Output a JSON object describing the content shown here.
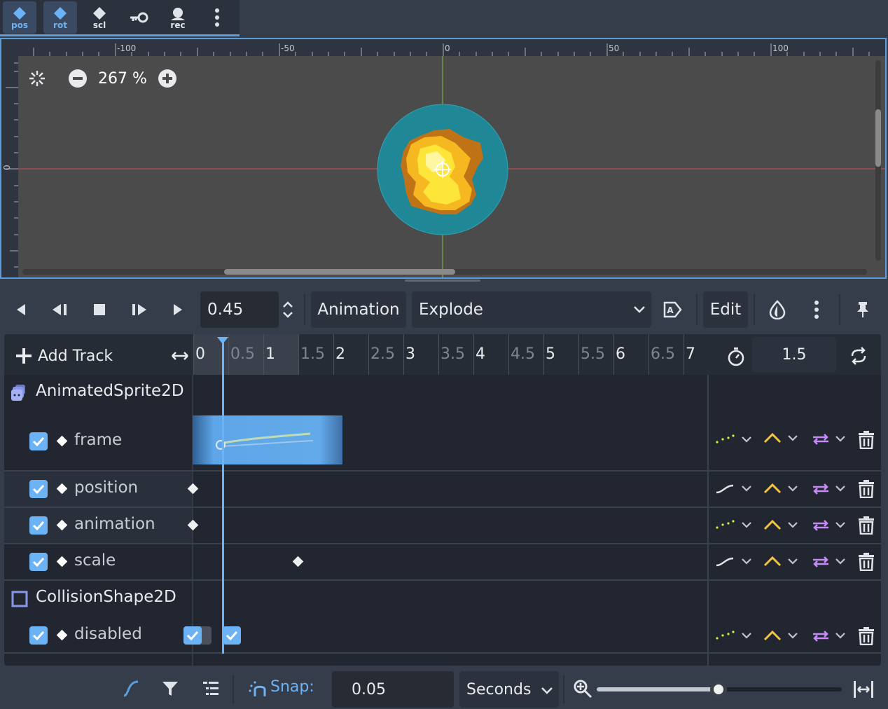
{
  "top_toolbar": {
    "buttons": [
      {
        "icon": "pos-key-icon",
        "label": "pos",
        "active": true
      },
      {
        "icon": "rot-key-icon",
        "label": "rot",
        "active": true
      },
      {
        "icon": "scl-key-icon",
        "label": "scl",
        "active": false
      },
      {
        "icon": "key-icon",
        "label": "",
        "active": false
      },
      {
        "icon": "rec-icon",
        "label": "rec",
        "active": false
      },
      {
        "icon": "more-vertical-icon",
        "label": "",
        "active": false
      }
    ]
  },
  "viewport": {
    "zoom": "267 %",
    "ruler_h_labels": [
      "-100",
      "-50",
      "0",
      "50",
      "100"
    ],
    "ruler_v_labels": [
      "0"
    ]
  },
  "anim_toolbar": {
    "time_value": "0.45",
    "animation_label": "Animation",
    "animation_selected": "Explode",
    "edit_label": "Edit"
  },
  "track_panel": {
    "add_track_label": "Add Track",
    "timeline_ticks": [
      "0",
      "0.5",
      "1",
      "1.5",
      "2",
      "2.5",
      "3",
      "3.5",
      "4",
      "4.5",
      "5",
      "5.5",
      "6",
      "6.5",
      "7"
    ],
    "length_value": "1.5",
    "playhead_time": 0.45,
    "groups": [
      {
        "name": "AnimatedSprite2D",
        "icon": "animated-sprite-icon",
        "tracks": [
          {
            "name": "frame",
            "enabled": true,
            "update_mode": "discrete",
            "keys": []
          },
          {
            "name": "position",
            "enabled": true,
            "update_mode": "continuous",
            "keys": [
              0
            ]
          },
          {
            "name": "animation",
            "enabled": true,
            "update_mode": "discrete",
            "keys": [
              0
            ]
          },
          {
            "name": "scale",
            "enabled": true,
            "update_mode": "continuous",
            "keys": [
              1.5
            ]
          }
        ]
      },
      {
        "name": "CollisionShape2D",
        "icon": "collision-shape-icon",
        "tracks": [
          {
            "name": "disabled",
            "enabled": true,
            "update_mode": "discrete",
            "keys": [
              0,
              0.5
            ]
          }
        ]
      }
    ]
  },
  "bottom_bar": {
    "snap_label": "Snap:",
    "snap_value": "0.05",
    "unit_selected": "Seconds",
    "zoom_level": 0.5
  },
  "colors": {
    "accent": "#5c9cdb",
    "checkbox": "#6cb3f5",
    "interp_yellow": "#f5c542",
    "loop_purple": "#c58af5",
    "discrete_green": "#c9f542"
  }
}
